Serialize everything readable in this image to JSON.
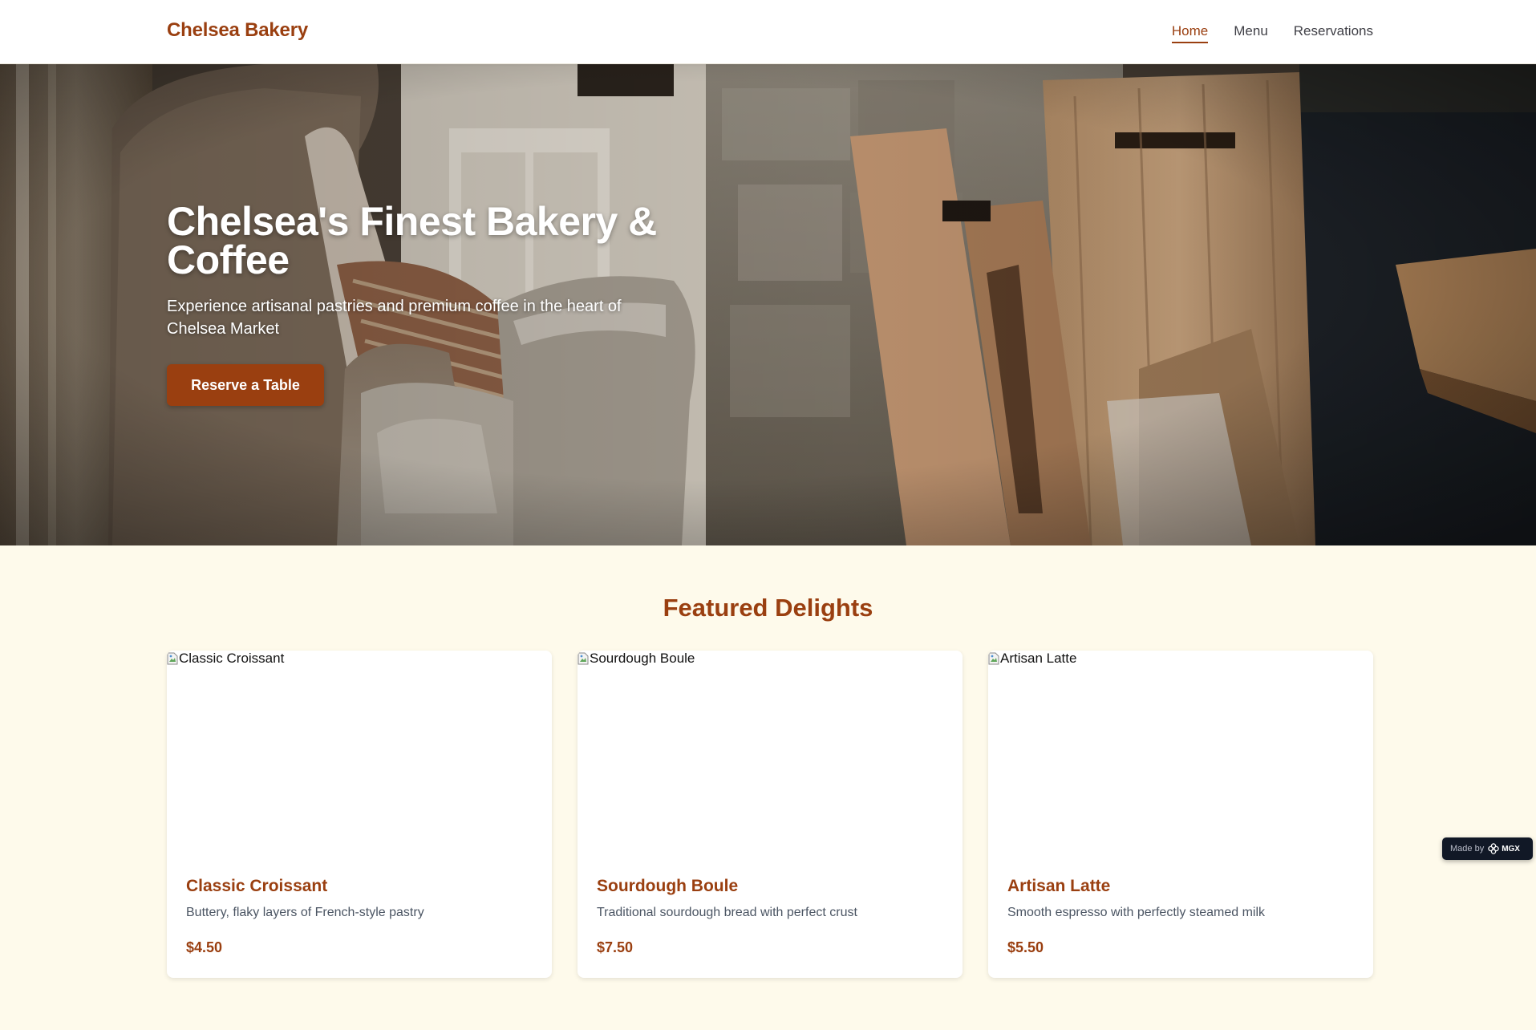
{
  "header": {
    "brand": "Chelsea Bakery",
    "nav": [
      {
        "label": "Home",
        "active": true
      },
      {
        "label": "Menu",
        "active": false
      },
      {
        "label": "Reservations",
        "active": false
      }
    ]
  },
  "hero": {
    "title": "Chelsea's Finest Bakery & Coffee",
    "subtitle": "Experience artisanal pastries and premium coffee in the heart of Chelsea Market",
    "cta_label": "Reserve a Table"
  },
  "featured": {
    "title": "Featured Delights",
    "items": [
      {
        "image_alt": "Classic Croissant",
        "name": "Classic Croissant",
        "description": "Buttery, flaky layers of French-style pastry",
        "price": "$4.50"
      },
      {
        "image_alt": "Sourdough Boule",
        "name": "Sourdough Boule",
        "description": "Traditional sourdough bread with perfect crust",
        "price": "$7.50"
      },
      {
        "image_alt": "Artisan Latte",
        "name": "Artisan Latte",
        "description": "Smooth espresso with perfectly steamed milk",
        "price": "$5.50"
      }
    ]
  },
  "badge": {
    "made_by": "Made by",
    "logo_text": "MGX"
  },
  "colors": {
    "brand": "#9a3f10",
    "page_bg": "#fefaeb",
    "card_bg": "#ffffff",
    "badge_bg": "#111826"
  },
  "icons": [
    "broken-image-icon",
    "mgx-logo-icon"
  ]
}
